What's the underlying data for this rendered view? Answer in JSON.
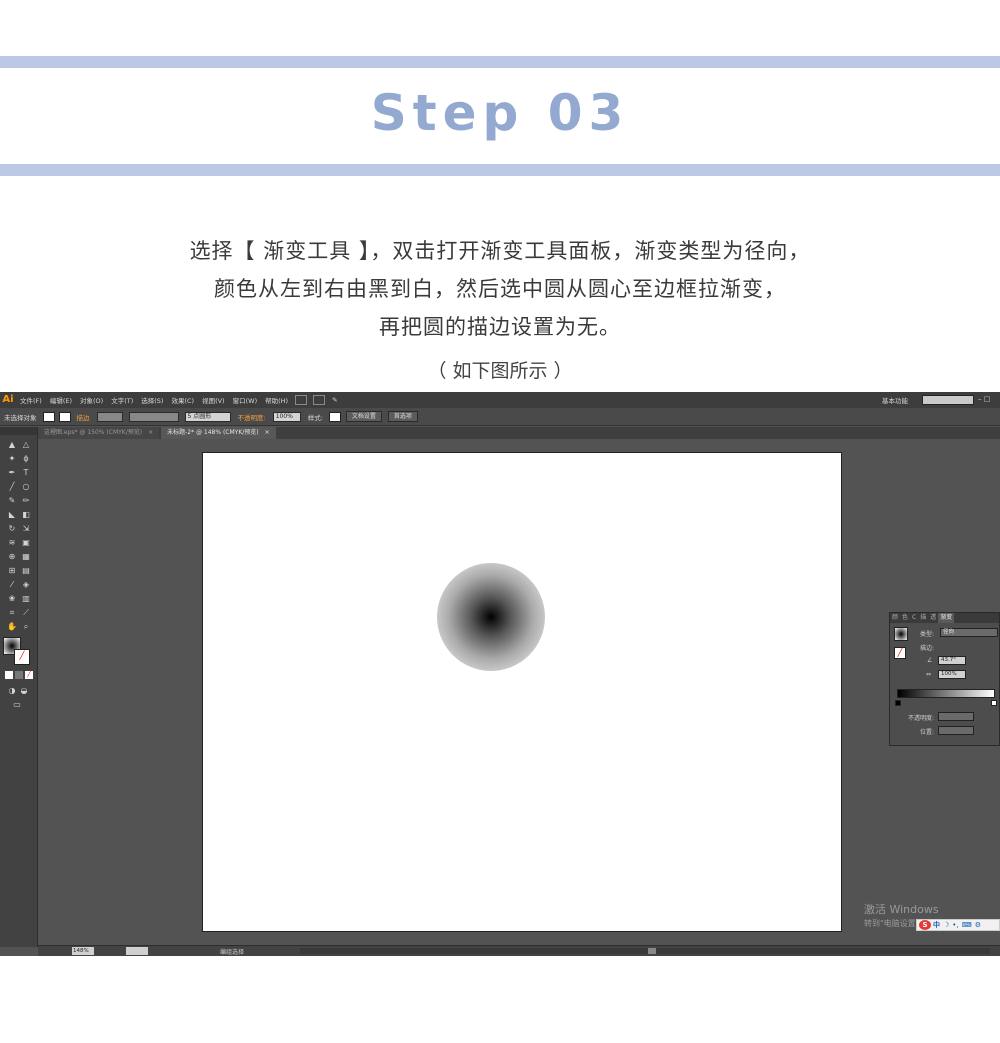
{
  "header": {
    "title": "Step 03"
  },
  "description": {
    "lines": [
      "选择【 渐变工具 】，双击打开渐变工具面板，渐变类型为径向，",
      "颜色从左到右由黑到白，然后选中圆从圆心至边框拉渐变，",
      "再把圆的描边设置为无。"
    ],
    "caption": "（ 如下图所示 ）"
  },
  "app": {
    "logo": "Ai",
    "menu": [
      "文件(F)",
      "编辑(E)",
      "对象(O)",
      "文字(T)",
      "选择(S)",
      "效果(C)",
      "视图(V)",
      "窗口(W)",
      "帮助(H)"
    ],
    "workspace": "基本功能",
    "control_bar": {
      "selection": "未选择对象",
      "stroke_label": "描边",
      "brush": "5 点圆形",
      "opacity_label": "不透明度:",
      "opacity_value": "100%",
      "style_label": "样式:",
      "doc_setup": "文档设置",
      "preferences": "首选项"
    },
    "tabs": [
      {
        "label": "这裡图.eps* @ 150% (CMYK/预览)",
        "close": "×"
      },
      {
        "label": "未标题-2* @ 148% (CMYK/预览)",
        "close": "×"
      }
    ],
    "gradient_panel": {
      "tabs": [
        "颜",
        "色",
        "C",
        "描",
        "透",
        "渐变"
      ],
      "type_label": "类型:",
      "type_value": "径向",
      "stroke_label": "描边:",
      "angle_value": "43.7°",
      "aspect_value": "100%",
      "opacity_label": "不透明度:",
      "location_label": "位置:"
    },
    "status": {
      "zoom": "148%",
      "mode": "编组选择"
    },
    "watermark": {
      "title": "激活 Windows",
      "subtitle": "转到\"电脑设置\""
    },
    "ime": {
      "logo": "S",
      "char": "中"
    }
  },
  "colors": {
    "band": "#bcc9e6",
    "title": "#93a9d0",
    "accent_orange": "#ff9a00"
  }
}
